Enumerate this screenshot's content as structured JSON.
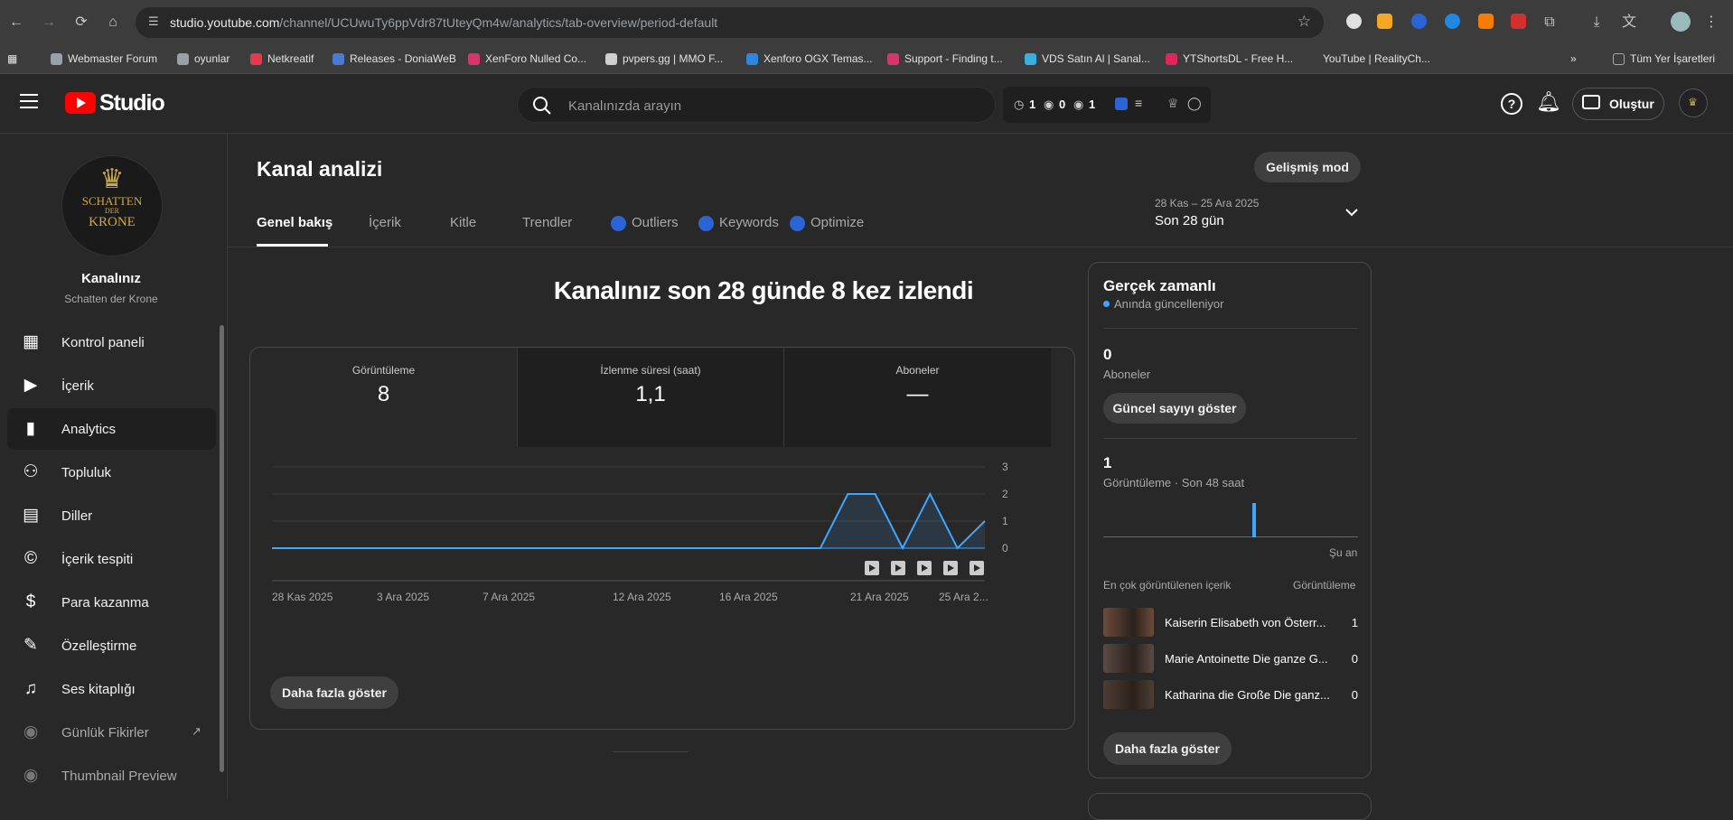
{
  "browser": {
    "url_host": "studio.youtube.com",
    "url_path": "/channel/UCUwuTy6ppVdr87tUteyQm4w/analytics/tab-overview/period-default",
    "bookmarks": [
      {
        "label": "Webmaster Forum",
        "color": "#9aa0a6"
      },
      {
        "label": "oyunlar",
        "color": "#9aa0a6"
      },
      {
        "label": "Netkreatif",
        "color": "#e53950"
      },
      {
        "label": "Releases - DoniaWeB",
        "color": "#4a7bd0"
      },
      {
        "label": "XenForo Nulled Co...",
        "color": "#d2386e"
      },
      {
        "label": "pvpers.gg | MMO F...",
        "color": "#cfcfcf"
      },
      {
        "label": "Xenforo OGX Temas...",
        "color": "#2f86e0"
      },
      {
        "label": "Support - Finding t...",
        "color": "#d2386e"
      },
      {
        "label": "VDS Satın Al | Sanal...",
        "color": "#37b0e0"
      },
      {
        "label": "YTShortsDL - Free H...",
        "color": "#e0245e"
      },
      {
        "label": "YouTube | RealityCh...",
        "color": "#3c3c3c"
      }
    ],
    "all_bookmarks": "Tüm Yer İşaretleri"
  },
  "header": {
    "logo_text": "Studio",
    "search_placeholder": "Kanalınızda arayın",
    "vidiq": {
      "a": "1",
      "b": "0",
      "c": "1"
    },
    "create_label": "Oluştur"
  },
  "sidebar": {
    "channel_title": "Kanalınız",
    "channel_name": "Schatten der Krone",
    "avatar_text": [
      "SCHATTEN",
      "DER",
      "KRONE"
    ],
    "items": [
      {
        "label": "Kontrol paneli",
        "name": "dashboard"
      },
      {
        "label": "İçerik",
        "name": "content"
      },
      {
        "label": "Analytics",
        "name": "analytics"
      },
      {
        "label": "Topluluk",
        "name": "community"
      },
      {
        "label": "Diller",
        "name": "subtitles"
      },
      {
        "label": "İçerik tespiti",
        "name": "copyright"
      },
      {
        "label": "Para kazanma",
        "name": "earn"
      },
      {
        "label": "Özelleştirme",
        "name": "customization"
      },
      {
        "label": "Ses kitaplığı",
        "name": "audio-library"
      },
      {
        "label": "Günlük Fikirler",
        "name": "daily-ideas"
      },
      {
        "label": "Thumbnail Preview",
        "name": "thumbnail-preview"
      }
    ]
  },
  "page": {
    "title": "Kanal analizi",
    "advanced_mode": "Gelişmiş mod",
    "tabs": [
      "Genel bakış",
      "İçerik",
      "Kitle",
      "Trendler",
      "Outliers",
      "Keywords",
      "Optimize"
    ],
    "date_range": "28 Kas – 25 Ara 2025",
    "period": "Son 28 gün",
    "headline": "Kanalınız son 28 günde 8 kez izlendi",
    "metrics": [
      {
        "label": "Görüntüleme",
        "value": "8"
      },
      {
        "label": "İzlenme süresi (saat)",
        "value": "1,1"
      },
      {
        "label": "Aboneler",
        "value": "—"
      }
    ],
    "show_more": "Daha fazla göster"
  },
  "chart_data": {
    "type": "line",
    "x_tick_labels": [
      "28 Kas 2025",
      "3 Ara 2025",
      "7 Ara 2025",
      "12 Ara 2025",
      "16 Ara 2025",
      "21 Ara 2025",
      "25 Ara 2..."
    ],
    "y_ticks": [
      "3",
      "2",
      "1",
      "0"
    ],
    "ylim": [
      0,
      3
    ],
    "values": [
      0,
      0,
      0,
      0,
      0,
      0,
      0,
      0,
      0,
      0,
      0,
      0,
      0,
      0,
      0,
      0,
      0,
      0,
      0,
      0,
      0,
      2,
      2,
      0,
      2,
      0,
      1
    ],
    "grid": true,
    "color": "#3ea6ff"
  },
  "realtime": {
    "title": "Gerçek zamanlı",
    "subtitle": "Anında güncelleniyor",
    "subs_value": "0",
    "subs_label": "Aboneler",
    "show_count": "Güncel sayıyı göster",
    "views_value": "1",
    "views_label": "Görüntüleme · Son 48 saat",
    "now_label": "Şu an",
    "top_content_header": "En çok görüntülenen içerik",
    "top_views_header": "Görüntüleme",
    "items": [
      {
        "title": "Kaiserin Elisabeth von Österr...",
        "views": "1"
      },
      {
        "title": "Marie Antoinette Die ganze G...",
        "views": "0"
      },
      {
        "title": "Katharina die Große Die ganz...",
        "views": "0"
      }
    ],
    "show_more": "Daha fazla göster"
  }
}
